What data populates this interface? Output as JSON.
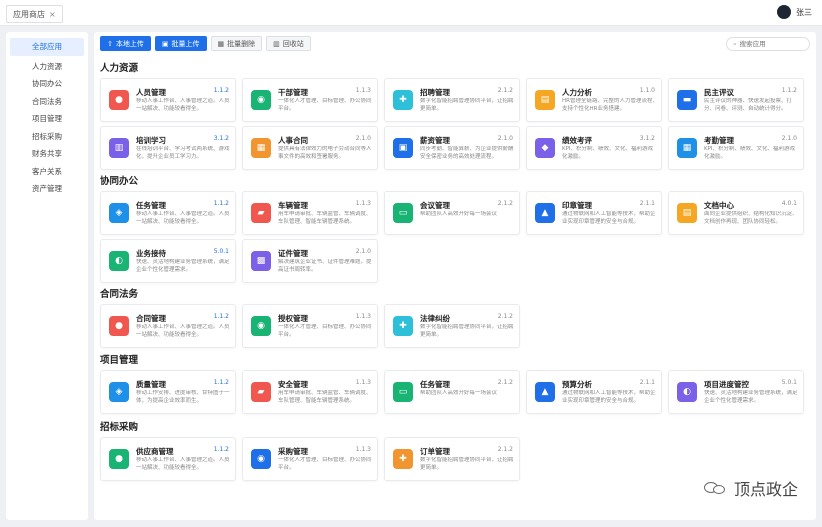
{
  "tab": {
    "label": "应用商店",
    "close": "×"
  },
  "user": {
    "name": "张三"
  },
  "sidebar": {
    "items": [
      "全部应用",
      "人力资源",
      "协同办公",
      "合同法务",
      "项目管理",
      "招标采购",
      "财务共享",
      "客户关系",
      "资产管理"
    ]
  },
  "toolbar": {
    "local_upload": "本地上传",
    "batch_upload": "批量上传",
    "batch_delete": "批量删除",
    "recycle": "回收站"
  },
  "search": {
    "placeholder": "搜索应用"
  },
  "sections": {
    "hr": "人力资源",
    "office": "协同办公",
    "legal": "合同法务",
    "project": "项目管理",
    "purchase": "招标采购"
  },
  "cards": [
    {
      "name": "人员管理",
      "ver": "1.1.2",
      "desc": "移动人事工作台、人事管理之道。人员一站解决、功能较看得全。",
      "color": "#f0584f",
      "icon": "person-icon"
    },
    {
      "name": "干部管理",
      "ver": "1.1.3",
      "desc": "一体化人才管理、目标管理、办公协同平台。",
      "color": "#19b373",
      "icon": "people-icon"
    },
    {
      "name": "招聘管理",
      "ver": "2.1.2",
      "desc": "数字化智能招聘管理协同平台，让招聘更简单。",
      "color": "#2ec0d8",
      "icon": "user-plus-icon"
    },
    {
      "name": "人力分析",
      "ver": "1.1.0",
      "desc": "HR管理全链路、完整的人力管理流程、支持个性化HR业务搭建。",
      "color": "#f5a623",
      "icon": "chart-icon"
    },
    {
      "name": "民主评议",
      "ver": "1.1.2",
      "desc": "民主评议的神器、快速发起投票、打分、问卷、评测、自动统计得分。",
      "color": "#1e6fe8",
      "icon": "chat-icon"
    },
    {
      "name": "培训学习",
      "ver": "3.1.2",
      "desc": "在线培训平台、学习考试两系统、游戏化，提升企业员工学习力。",
      "color": "#7b61e8",
      "icon": "book-icon"
    },
    {
      "name": "人事合同",
      "ver": "2.1.0",
      "desc": "提供具有法律效力的电子劳动合同等人事文件的高效和签署服务。",
      "color": "#f0952f",
      "icon": "contract-icon"
    },
    {
      "name": "薪资管理",
      "ver": "2.1.0",
      "desc": "同步考勤、智能算薪、为企业提供薪酬安全保密业务的高效处理流程。",
      "color": "#1e6fe8",
      "icon": "wallet-icon"
    },
    {
      "name": "绩效考评",
      "ver": "3.1.2",
      "desc": "KPI、积分制、绩效、文化、福利游戏化激励。",
      "color": "#7b61e8",
      "icon": "performance-icon"
    },
    {
      "name": "考勤管理",
      "ver": "2.1.0",
      "desc": "KPI、积分制、绩效、文化、福利游戏化激励。",
      "color": "#1e90e8",
      "icon": "calendar-icon"
    },
    {
      "name": "任务管理",
      "ver": "1.1.2",
      "desc": "移动人事工作台、人事管理之道。人员一站解决、功能较看得全。",
      "color": "#1e90e8",
      "icon": "task-icon"
    },
    {
      "name": "车辆管理",
      "ver": "1.1.3",
      "desc": "用车申请审批、车辆监管、车辆调度、车队管理、智能车辆管理系统。",
      "color": "#f0584f",
      "icon": "car-icon"
    },
    {
      "name": "会议管理",
      "ver": "2.1.2",
      "desc": "帮助团队人高效开好每一场会议",
      "color": "#19b373",
      "icon": "meeting-icon"
    },
    {
      "name": "印章管理",
      "ver": "2.1.1",
      "desc": "通过物联网和人工智能等技术，帮助企业实现印章管理的安全与合规。",
      "color": "#1e6fe8",
      "icon": "seal-icon"
    },
    {
      "name": "文档中心",
      "ver": "4.0.1",
      "desc": "面向企业提供组织、结构化知识沉淀、文档创作再现、团队协同轻松。",
      "color": "#f5a623",
      "icon": "document-icon"
    },
    {
      "name": "业务接待",
      "ver": "5.0.1",
      "desc": "快速、灵活地构建业务管理系统，满足企业个性化管理需求。",
      "color": "#19b373",
      "icon": "reception-icon"
    },
    {
      "name": "证件管理",
      "ver": "2.1.0",
      "desc": "解决建筑企业证书、证件管理难题，提高证书周转率。",
      "color": "#7b61e8",
      "icon": "certificate-icon"
    },
    {
      "name": "合同管理",
      "ver": "1.1.2",
      "desc": "移动人事工作台、人事管理之道。人员一站解决、功能较看得全。",
      "color": "#f0584f",
      "icon": "contract-mgmt-icon"
    },
    {
      "name": "授权管理",
      "ver": "1.1.3",
      "desc": "一体化人才管理、目标管理、办公协同平台。",
      "color": "#19b373",
      "icon": "authorize-icon"
    },
    {
      "name": "法律纠纷",
      "ver": "2.1.2",
      "desc": "数字化智能招聘管理协同平台，让招聘更简单。",
      "color": "#2ec0d8",
      "icon": "law-icon"
    },
    {
      "name": "质量管理",
      "ver": "1.1.2",
      "desc": "移动工作安排、进度审核、甘特图于一体，为提高企业效率而生。",
      "color": "#1e90e8",
      "icon": "quality-icon"
    },
    {
      "name": "安全管理",
      "ver": "1.1.3",
      "desc": "用车申请审批、车辆监管、车辆调度、车队管理、智能车辆管理系统。",
      "color": "#f0584f",
      "icon": "safety-icon"
    },
    {
      "name": "任务管理",
      "ver": "2.1.2",
      "desc": "帮助团队人高效开好每一场会议",
      "color": "#19b373",
      "icon": "task2-icon"
    },
    {
      "name": "预算分析",
      "ver": "2.1.1",
      "desc": "通过物联网和人工智能等技术，帮助企业实现印章管理的安全与合规。",
      "color": "#1e6fe8",
      "icon": "budget-icon"
    },
    {
      "name": "项目进度管控",
      "ver": "5.0.1",
      "desc": "快速、灵活地构建业务管理系统，满足企业个性化管理需求。",
      "color": "#7b61e8",
      "icon": "progress-icon"
    },
    {
      "name": "供应商管理",
      "ver": "1.1.2",
      "desc": "移动人事工作台、人事管理之道。人员一站解决、功能较看得全。",
      "color": "#19b373",
      "icon": "supplier-icon"
    },
    {
      "name": "采购管理",
      "ver": "1.1.3",
      "desc": "一体化人才管理、目标管理、办公协同平台。",
      "color": "#1e6fe8",
      "icon": "purchase-icon"
    },
    {
      "name": "订单管理",
      "ver": "2.1.2",
      "desc": "数字化智能招聘管理协同平台，让招聘更简单。",
      "color": "#f0952f",
      "icon": "order-icon"
    }
  ],
  "watermark": {
    "text": "顶点政企"
  }
}
